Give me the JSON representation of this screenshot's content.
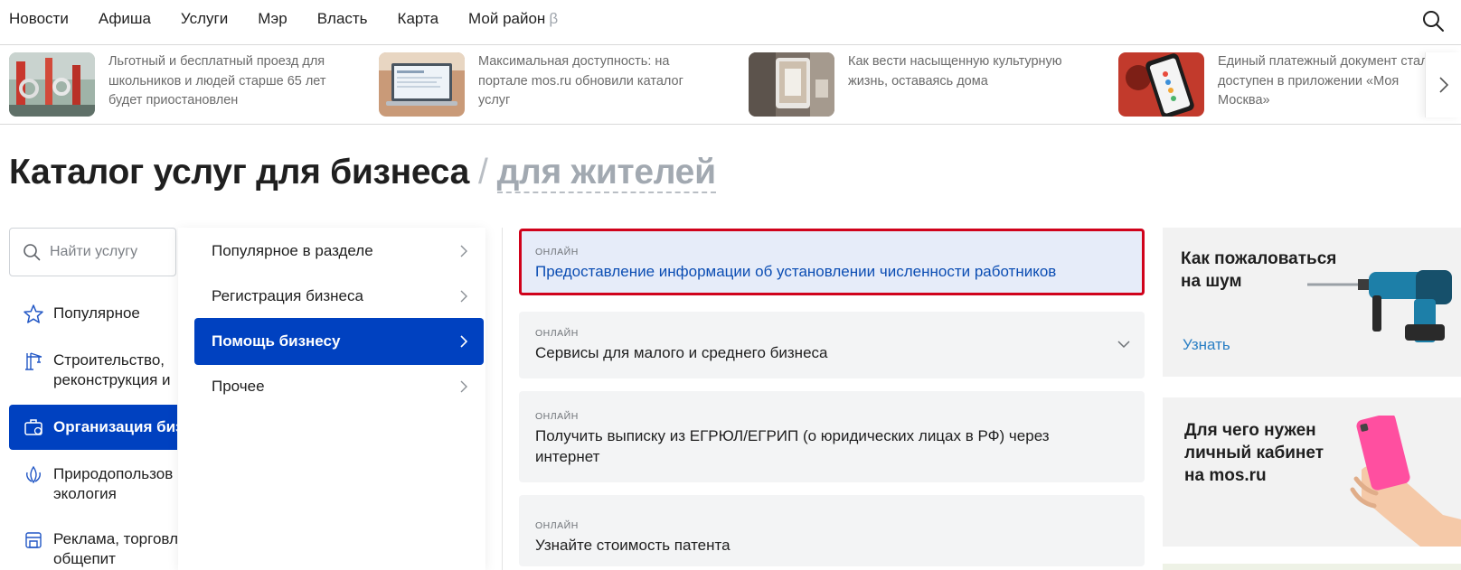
{
  "nav": {
    "items": [
      "Новости",
      "Афиша",
      "Услуги",
      "Мэр",
      "Власть",
      "Карта"
    ],
    "district_label": "Мой район",
    "district_badge": "β",
    "search_icon": "search-icon"
  },
  "news": [
    {
      "text": "Льготный и бесплатный проезд для школьников и людей старше 65 лет будет приостановлен",
      "thumb": "bus-handrail-photo"
    },
    {
      "text": "Максимальная доступность: на портале mos.ru обновили каталог услуг",
      "thumb": "laptop-photo"
    },
    {
      "text": "Как вести насыщенную культурную жизнь, оставаясь дома",
      "thumb": "tablet-museum-photo"
    },
    {
      "text": "Единый платежный документ стал доступен в приложении «Моя Москва»",
      "thumb": "phone-app-photo"
    }
  ],
  "heading": {
    "main": "Каталог услуг для бизнеса",
    "separator": "/",
    "alt": "для жителей"
  },
  "search": {
    "placeholder": "Найти услугу"
  },
  "categories": [
    {
      "line1": "Популярное",
      "line2": "",
      "icon": "star-icon"
    },
    {
      "line1": "Строительство,",
      "line2": "реконструкция и",
      "icon": "crane-icon"
    },
    {
      "line1": "Организация биз",
      "line2": "",
      "icon": "briefcase-icon"
    },
    {
      "line1": "Природопользов",
      "line2": "экология",
      "icon": "leaf-drop-icon"
    },
    {
      "line1": "Реклама, торговл",
      "line2": "общепит",
      "icon": "shop-icon"
    }
  ],
  "subcategories": [
    "Популярное в разделе",
    "Регистрация бизнеса",
    "Помощь бизнесу",
    "Прочее"
  ],
  "services": [
    {
      "tag": "онлайн",
      "title": "Предоставление информации об установлении численности работников"
    },
    {
      "tag": "онлайн",
      "title": "Сервисы для малого и среднего бизнеса"
    },
    {
      "tag": "онлайн",
      "title": "Получить выписку из ЕГРЮЛ/ЕГРИП (о юридических лицах в РФ) через интернет"
    },
    {
      "tag": "онлайн",
      "title": "Узнайте стоимость патента"
    }
  ],
  "promos": [
    {
      "title_line1": "Как пожаловаться",
      "title_line2": "на шум",
      "link": "Узнать",
      "image": "drill-icon"
    },
    {
      "title_line1": "Для чего нужен",
      "title_line2": "личный кабинет",
      "title_line3": "на mos.ru",
      "image": "hand-phone-icon"
    }
  ],
  "colors": {
    "accent": "#0041c0",
    "highlight_border": "#d0021b",
    "link": "#2a7fc4"
  }
}
